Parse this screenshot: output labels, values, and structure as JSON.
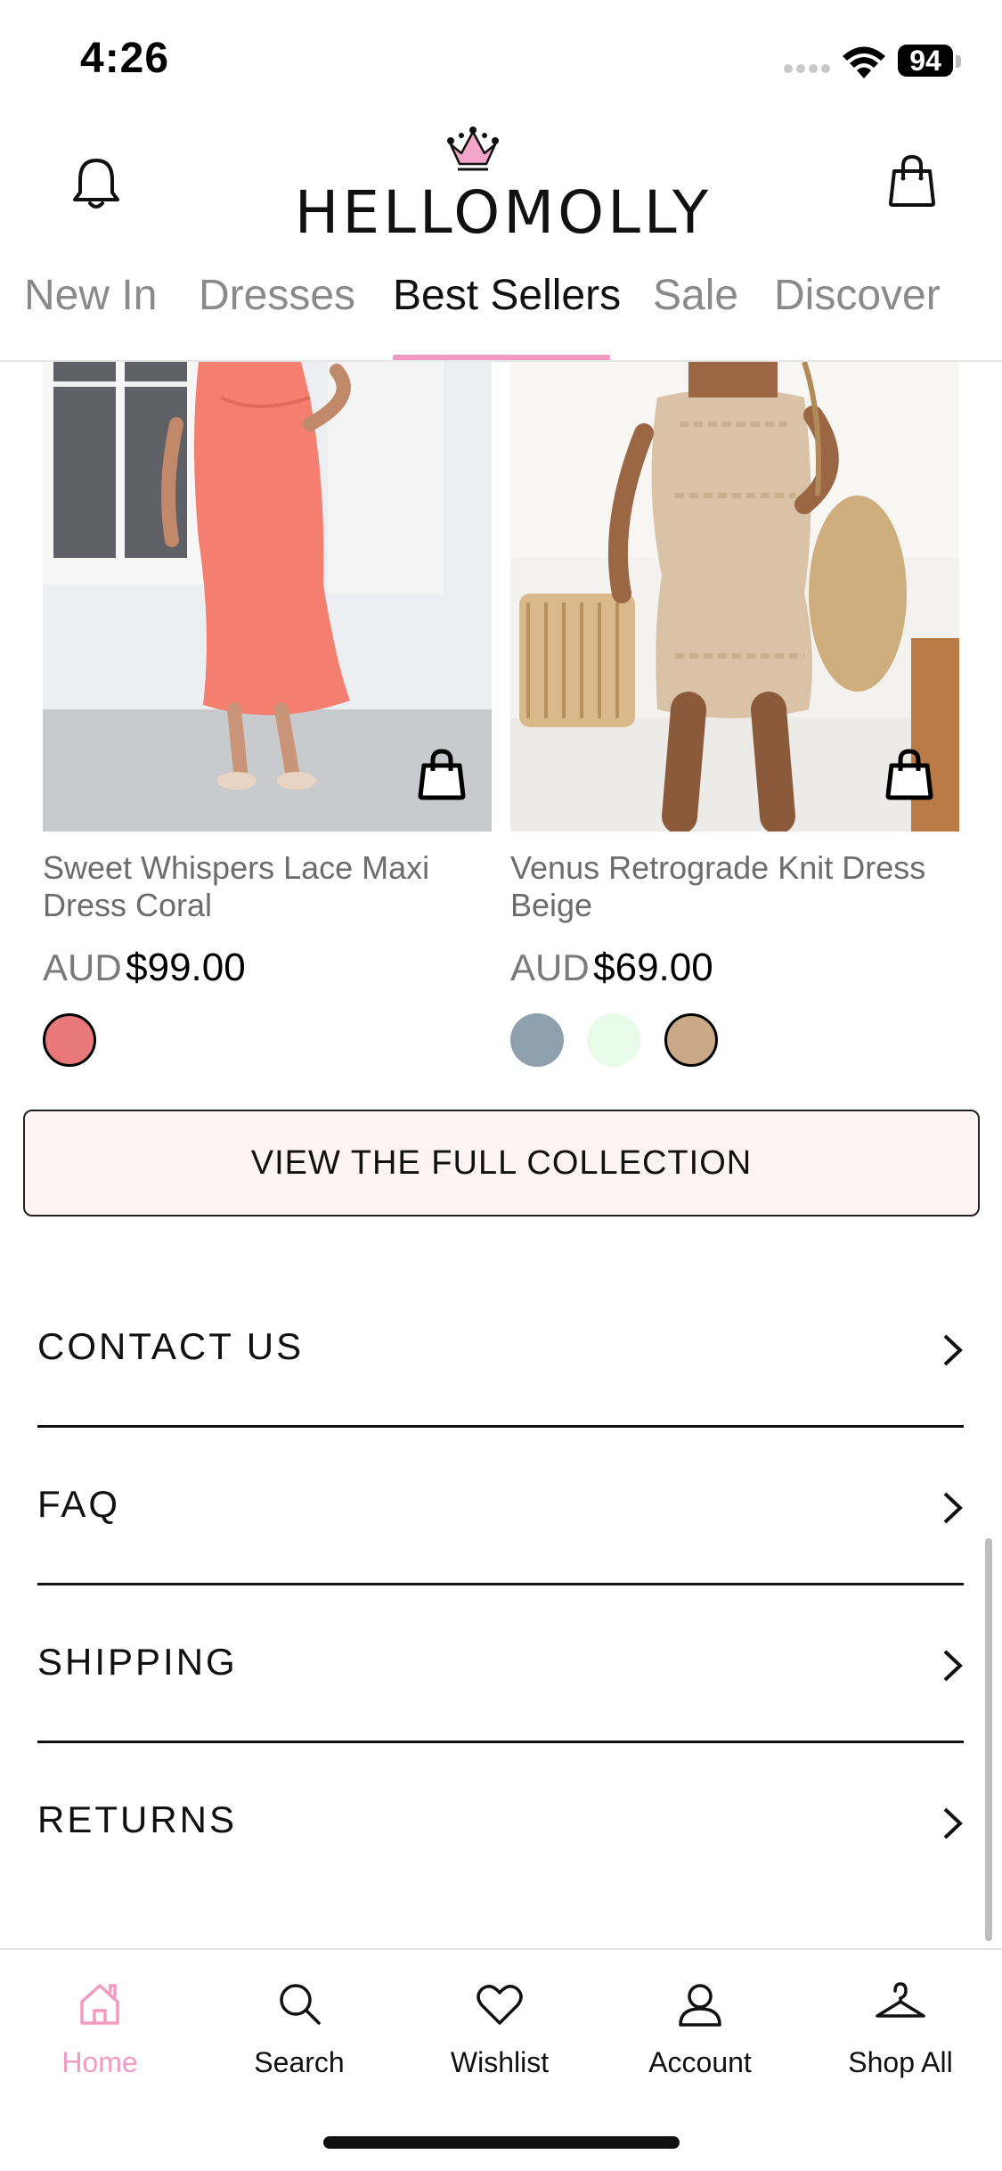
{
  "status": {
    "time": "4:26",
    "battery": "94"
  },
  "header": {
    "logo": "HELLOMOLLY"
  },
  "tabs": [
    {
      "label": "New In"
    },
    {
      "label": "Dresses"
    },
    {
      "label": "Best Sellers"
    },
    {
      "label": "Sale"
    },
    {
      "label": "Discover"
    }
  ],
  "active_tab": "Best Sellers",
  "products": [
    {
      "name": "Sweet Whispers Lace Maxi Dress Coral",
      "currency": "AUD",
      "price": "$99.00",
      "swatches": [
        {
          "color": "#e8787a",
          "selected": true
        }
      ]
    },
    {
      "name": "Venus Retrograde Knit Dress Beige",
      "currency": "AUD",
      "price": "$69.00",
      "swatches": [
        {
          "color": "#8e9fae",
          "selected": false
        },
        {
          "color": "#e8fbe9",
          "selected": false
        },
        {
          "color": "#c9a888",
          "selected": true
        }
      ]
    }
  ],
  "collection_button": "VIEW THE FULL COLLECTION",
  "info_links": [
    {
      "label": "CONTACT US"
    },
    {
      "label": "FAQ"
    },
    {
      "label": "SHIPPING"
    },
    {
      "label": "RETURNS"
    }
  ],
  "bottom_nav": [
    {
      "label": "Home",
      "icon": "home-icon",
      "active": true
    },
    {
      "label": "Search",
      "icon": "search-icon",
      "active": false
    },
    {
      "label": "Wishlist",
      "icon": "heart-icon",
      "active": false
    },
    {
      "label": "Account",
      "icon": "user-icon",
      "active": false
    },
    {
      "label": "Shop All",
      "icon": "hanger-icon",
      "active": false
    }
  ],
  "colors": {
    "accent_pink": "#f29ac2",
    "button_bg": "#fdf3f2"
  }
}
